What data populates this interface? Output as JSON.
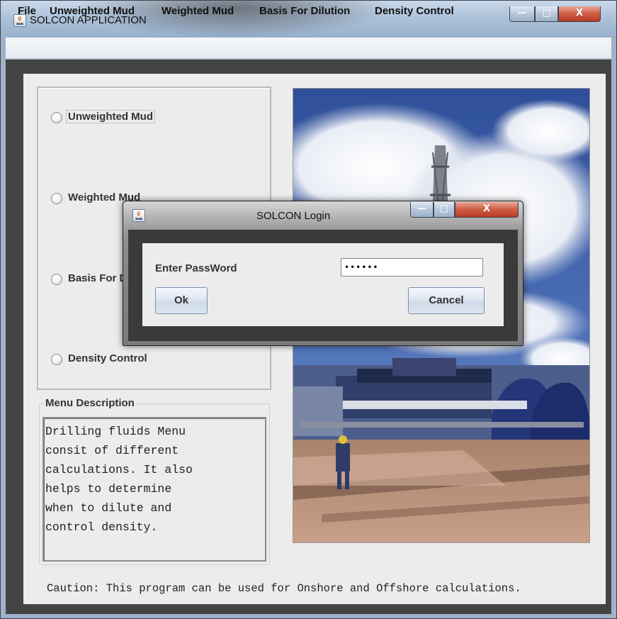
{
  "window": {
    "title": "SOLCON APPLICATION",
    "controls": {
      "minimize": "—",
      "maximize": "□",
      "close": "X"
    }
  },
  "menubar": {
    "items": [
      "File",
      "Unweighted Mud",
      "Weighted Mud",
      "Basis For Dilution",
      "Density Control"
    ]
  },
  "options": {
    "items": [
      {
        "label": "Unweighted Mud",
        "selected": false,
        "focused": true
      },
      {
        "label": "Weighted Mud",
        "selected": false,
        "focused": false
      },
      {
        "label": "Basis For Dilution",
        "selected": false,
        "focused": false
      },
      {
        "label": "Density Control",
        "selected": false,
        "focused": false
      }
    ]
  },
  "description": {
    "title": "Menu Description",
    "text": "Drilling fluids Menu\nconsit of  different\ncalculations. It also\nhelps to determine\nwhen to dilute and\ncontrol density."
  },
  "caution": "Caution: This program can be used for Onshore and Offshore calculations.",
  "dialog": {
    "title": "SOLCON Login",
    "password_label": "Enter PassWord",
    "password_value": "••••••",
    "ok_label": "Ok",
    "cancel_label": "Cancel",
    "controls": {
      "minimize": "—",
      "maximize": "□",
      "close": "X"
    }
  },
  "photo": {
    "icon": "oil-rig-photo"
  },
  "colors": {
    "accent": "#9bb0c8",
    "close": "#c9452b"
  }
}
